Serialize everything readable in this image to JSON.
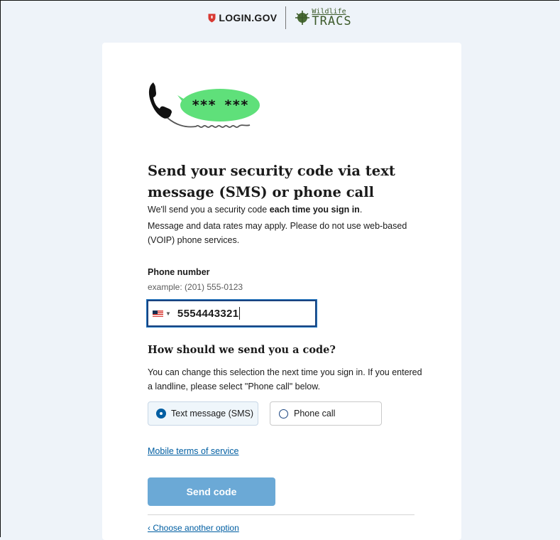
{
  "header": {
    "login_logo_text": "LOGIN.GOV",
    "partner_line1": "Wildlife",
    "partner_line2": "TRACS"
  },
  "illustration": {
    "bubble_text": "*** ***",
    "bubble_color": "#5fe07a"
  },
  "heading": "Send your security code via text message (SMS) or phone call",
  "intro": {
    "line1_pre": "We'll send you a security code ",
    "line1_bold": "each time you sign in",
    "line1_post": ".",
    "line2": "Message and data rates may apply. Please do not use web-based (VOIP) phone services."
  },
  "phone": {
    "label": "Phone number",
    "hint": "example: (201) 555-0123",
    "country_icon": "us-flag-icon",
    "value": "5554443321"
  },
  "delivery": {
    "heading": "How should we send you a code?",
    "description": "You can change this selection the next time you sign in. If you entered a landline, please select \"Phone call\" below.",
    "options": [
      {
        "label": "Text message (SMS)",
        "selected": true
      },
      {
        "label": "Phone call",
        "selected": false
      }
    ]
  },
  "terms_link": "Mobile terms of service",
  "send_button": "Send code",
  "back_link": "‹ Choose another option",
  "colors": {
    "primary": "#005ea2",
    "button_disabled": "#6ba9d6",
    "background": "#eef3f9",
    "login_red": "#d83933"
  }
}
